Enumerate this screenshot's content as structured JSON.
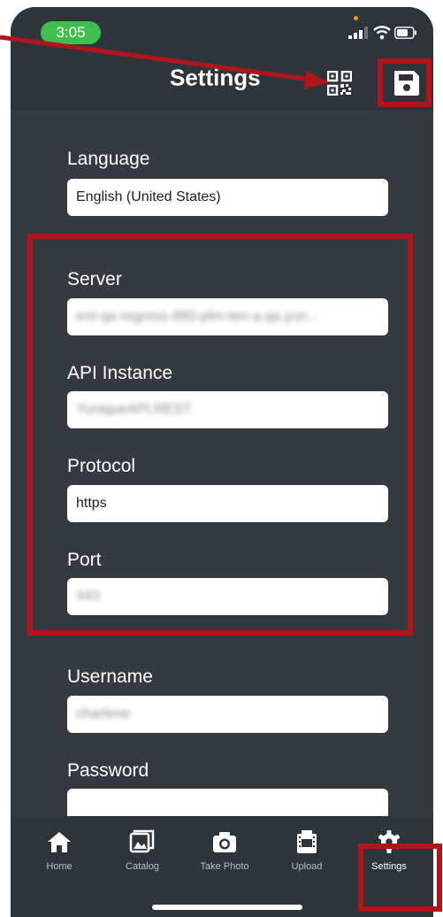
{
  "statusbar": {
    "time": "3:05"
  },
  "header": {
    "title": "Settings"
  },
  "form": {
    "language": {
      "label": "Language",
      "value": "English (United States)"
    },
    "server": {
      "label": "Server",
      "value": "ent-qa-regress-880-plm-ten-a.qa.yun..."
    },
    "api_instance": {
      "label": "API Instance",
      "value": "YuniqueAPI.REST"
    },
    "protocol": {
      "label": "Protocol",
      "value": "https"
    },
    "port": {
      "label": "Port",
      "value": "443"
    },
    "username": {
      "label": "Username",
      "value": "charlene"
    },
    "password": {
      "label": "Password",
      "value": ""
    }
  },
  "nav": {
    "items": [
      {
        "label": "Home",
        "icon": "home-icon"
      },
      {
        "label": "Catalog",
        "icon": "image-icon"
      },
      {
        "label": "Take Photo",
        "icon": "camera-icon"
      },
      {
        "label": "Upload",
        "icon": "film-icon"
      },
      {
        "label": "Settings",
        "icon": "gear-icon"
      }
    ],
    "active": "Settings"
  },
  "colors": {
    "background": "#343a40",
    "header": "#2d353b",
    "annotation_red": "#b1141b",
    "status_pill": "#3fbf4e"
  }
}
